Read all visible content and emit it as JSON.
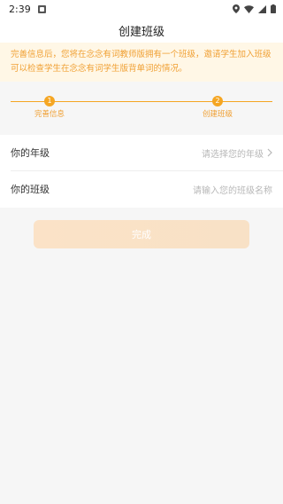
{
  "status_bar": {
    "time": "2:39",
    "icons": [
      "notification-icon",
      "location-icon",
      "wifi-icon",
      "signal-icon",
      "battery-icon"
    ]
  },
  "header": {
    "title": "创建班级"
  },
  "notice": {
    "text": "完善信息后，您将在念念有词教师版拥有一个班级，邀请学生加入班级可以检查学生在念念有词学生版背单词的情况。"
  },
  "steps": [
    {
      "number": "1",
      "label": "完善信息"
    },
    {
      "number": "2",
      "label": "创建班级"
    }
  ],
  "form": {
    "grade": {
      "label": "你的年级",
      "placeholder": "请选择您的年级"
    },
    "class": {
      "label": "你的班级",
      "placeholder": "请输入您的班级名称"
    }
  },
  "actions": {
    "done_label": "完成"
  },
  "colors": {
    "accent": "#f5a623",
    "notice_bg": "#fff7e6",
    "notice_text": "#f0a034",
    "button_bg": "#fbe2c7"
  }
}
